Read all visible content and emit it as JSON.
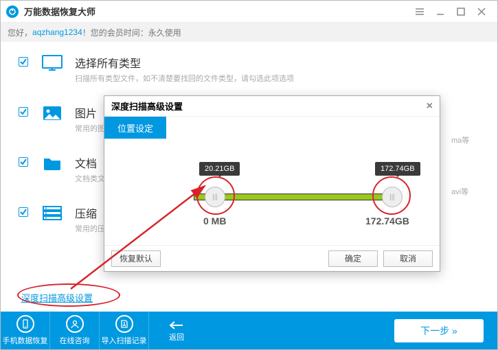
{
  "app": {
    "title": "万能数据恢复大师"
  },
  "subbar": {
    "greet": "您好，",
    "username": "aqzhang1234",
    "suffix": "！您的会员时间：永久使用"
  },
  "rows": [
    {
      "title": "选择所有类型",
      "desc": "扫描所有类型文件，如不清楚要找回的文件类型，请勾选此项选项"
    },
    {
      "title": "图片",
      "desc": "常用的图"
    },
    {
      "title": "文档",
      "desc": "文档类文"
    },
    {
      "title": "压缩",
      "desc": "常用的压"
    }
  ],
  "suffixes": {
    "s1": "ma等",
    "s2": "avi等"
  },
  "deepscan_link": "深度扫描高级设置",
  "bottom": {
    "phone": "手机数据恢复",
    "chat": "在线咨询",
    "import": "导入扫描记录",
    "back": "返回",
    "next": "下一步 »"
  },
  "dialog": {
    "title": "深度扫描高级设置",
    "tab": "位置设定",
    "leftBubble": "20.21GB",
    "rightBubble": "172.74GB",
    "leftLabel": "0 MB",
    "rightLabel": "172.74GB",
    "restore": "恢复默认",
    "ok": "确定",
    "cancel": "取消"
  }
}
